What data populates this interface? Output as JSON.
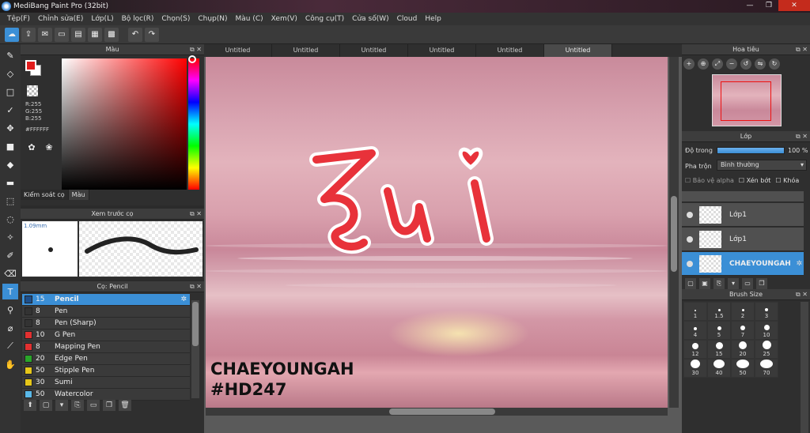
{
  "window": {
    "title": "MediBang Paint Pro (32bit)",
    "minimize": "—",
    "maximize": "❐",
    "close": "✕"
  },
  "menu": [
    "Tệp(F)",
    "Chỉnh sửa(E)",
    "Lớp(L)",
    "Bộ lọc(R)",
    "Chọn(S)",
    "Chụp(N)",
    "Màu (C)",
    "Xem(V)",
    "Công cụ(T)",
    "Cửa số(W)",
    "Cloud",
    "Help"
  ],
  "color_panel": {
    "title": "Màu",
    "r": "R:255",
    "g": "G:255",
    "b": "B:255",
    "hex": "#FFFFFF",
    "tabs": [
      "Kiểm soát cọ",
      "Màu"
    ],
    "primary_color": "#e11d1d",
    "secondary_color": "#ffffff"
  },
  "brush_preview": {
    "title": "Xem trước cọ",
    "size": "1.09mm"
  },
  "brush_list": {
    "title": "Cọ: Pencil",
    "items": [
      {
        "size": "15",
        "name": "Pencil",
        "color": "#1e4f8a"
      },
      {
        "size": "8",
        "name": "Pen",
        "color": "#333333"
      },
      {
        "size": "8",
        "name": "Pen (Sharp)",
        "color": "#333333"
      },
      {
        "size": "10",
        "name": "G Pen",
        "color": "#e23030"
      },
      {
        "size": "8",
        "name": "Mapping Pen",
        "color": "#e23030"
      },
      {
        "size": "20",
        "name": "Edge Pen",
        "color": "#2aa52a"
      },
      {
        "size": "50",
        "name": "Stipple Pen",
        "color": "#e6c619"
      },
      {
        "size": "30",
        "name": "Sumi",
        "color": "#e6c619"
      },
      {
        "size": "50",
        "name": "Watercolor",
        "color": "#5ab8e8"
      }
    ]
  },
  "tabs": [
    "Untitled",
    "Untitled",
    "Untitled",
    "Untitled",
    "Untitled",
    "Untitled"
  ],
  "canvas": {
    "signature_line1": "CHAEYOUNGAH",
    "signature_line2": "#HD247"
  },
  "navigator": {
    "title": "Hoa tiêu"
  },
  "layer_panel": {
    "title": "Lớp",
    "opacity_label": "Độ trong",
    "opacity_value": "100 %",
    "blend_label": "Pha trộn",
    "blend_value": "Bình thường",
    "protect_alpha": "Bảo vệ alpha",
    "clipping": "Xén bớt",
    "lock": "Khóa",
    "layers": [
      {
        "name": "Lớp1"
      },
      {
        "name": "Lớp1"
      },
      {
        "name": "CHAEYOUNGAH"
      }
    ]
  },
  "brush_size": {
    "title": "Brush Size",
    "sizes": [
      "1",
      "1.5",
      "2",
      "3",
      "4",
      "5",
      "7",
      "10",
      "12",
      "15",
      "20",
      "25",
      "30",
      "40",
      "50",
      "70"
    ]
  }
}
